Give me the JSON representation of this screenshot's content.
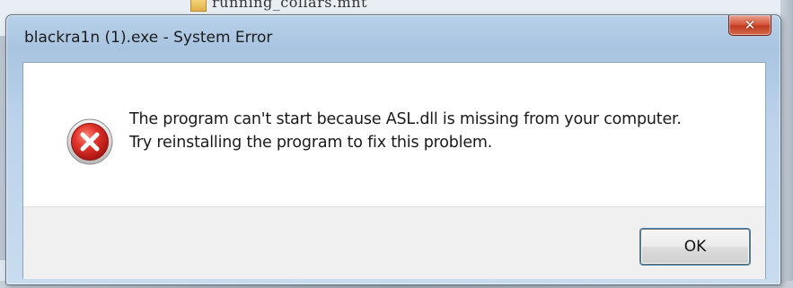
{
  "background": {
    "file_name": "running_collars.mnt"
  },
  "dialog": {
    "title": "blackra1n (1).exe - System Error",
    "close_icon": "close-icon",
    "icon": "error-icon",
    "message_lines": [
      "The program can't start because ASL.dll is missing from your computer.",
      "Try reinstalling the program to fix this problem."
    ],
    "ok_label": "OK"
  },
  "colors": {
    "close_button": "#c9452b",
    "error_icon": "#c8201a",
    "title_bar": "#b9d1ea"
  }
}
